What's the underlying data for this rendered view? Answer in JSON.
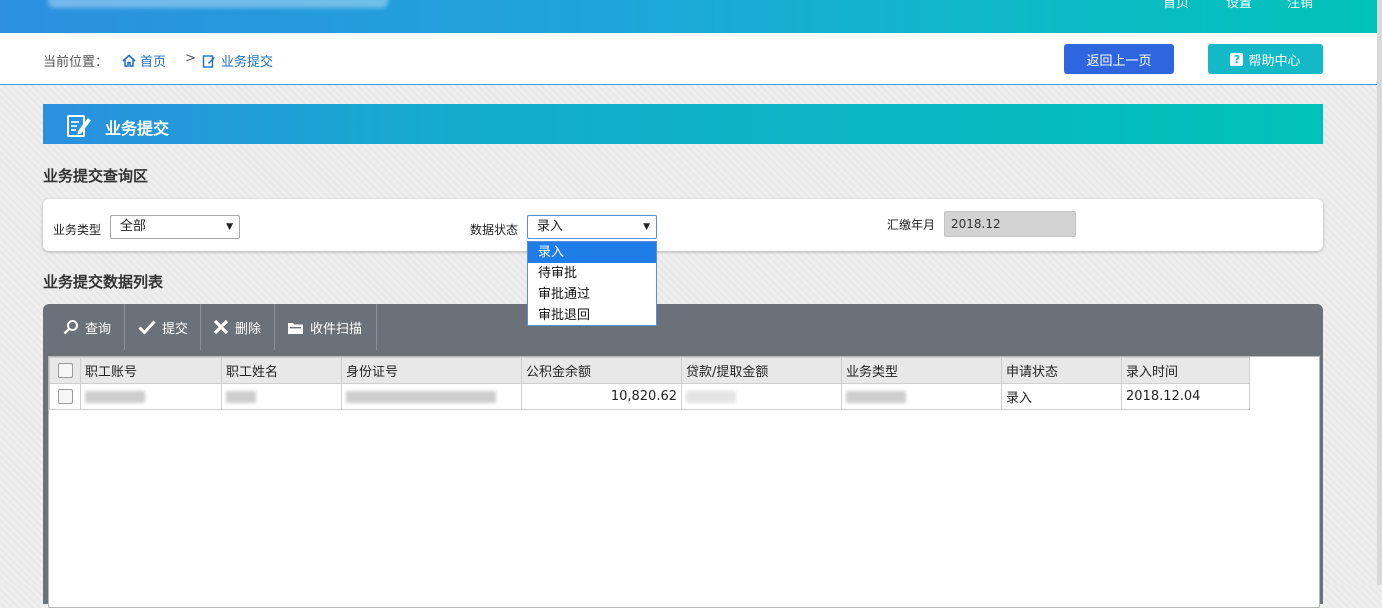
{
  "topnav": {
    "home": "首页",
    "settings": "设置",
    "logout": "注销"
  },
  "breadcrumb": {
    "label": "当前位置：",
    "home": "首页",
    "separator": ">",
    "current": "业务提交"
  },
  "buttons": {
    "back": "返回上一页",
    "help": "帮助中心"
  },
  "panel": {
    "title": "业务提交"
  },
  "query_section": {
    "title": "业务提交查询区",
    "business_type_label": "业务类型",
    "business_type_value": "全部",
    "data_status_label": "数据状态",
    "data_status_value": "录入",
    "data_status_options": [
      "录入",
      "待审批",
      "审批通过",
      "审批退回"
    ],
    "year_month_label": "汇缴年月",
    "year_month_value": "2018.12"
  },
  "list_section": {
    "title": "业务提交数据列表",
    "toolbar": {
      "query": "查询",
      "submit": "提交",
      "delete": "删除",
      "scan": "收件扫描"
    },
    "columns": [
      "职工账号",
      "职工姓名",
      "身份证号",
      "公积金余额",
      "贷款/提取金额",
      "业务类型",
      "申请状态",
      "录入时间"
    ],
    "rows": [
      {
        "balance": "10,820.62",
        "status": "录入",
        "entry_time": "2018.12.04"
      }
    ]
  },
  "colors": {
    "accent_blue": "#2c8fe0",
    "accent_teal": "#00c2b8",
    "back_button": "#2f66e0",
    "help_button": "#13b9c7",
    "toolbar": "#6b7179"
  }
}
